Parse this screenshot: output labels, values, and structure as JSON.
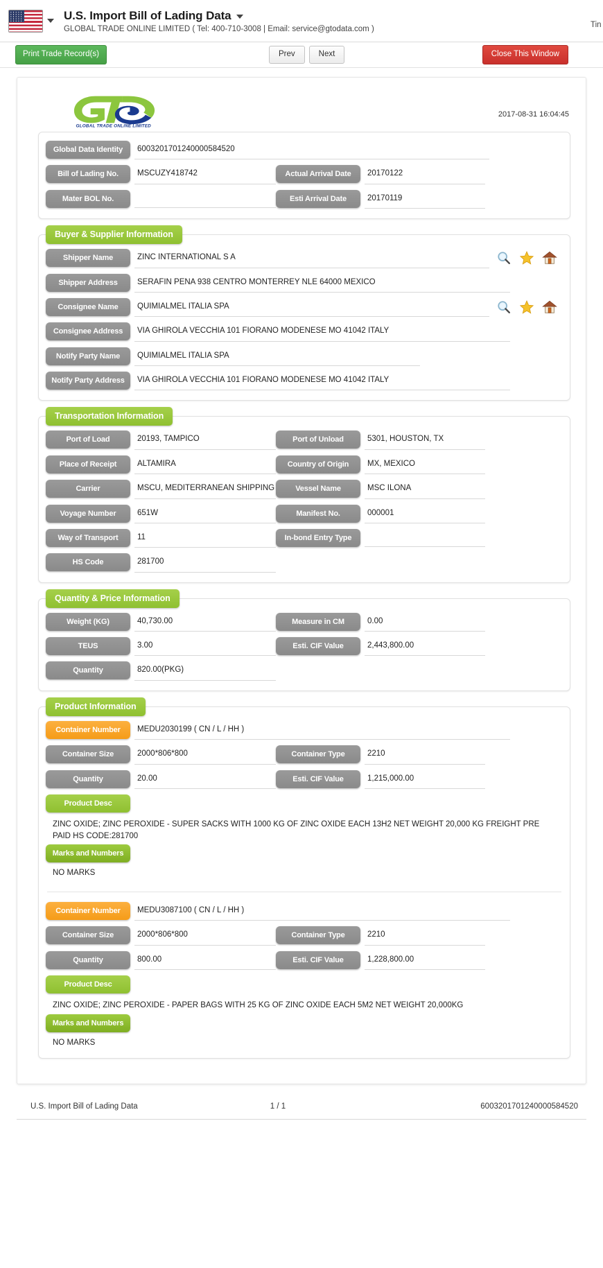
{
  "header": {
    "flag_icon": "us-flag-icon",
    "title": "U.S. Import Bill of Lading Data",
    "subtitle": "GLOBAL TRADE ONLINE LIMITED ( Tel: 400-710-3008 | Email: service@gtodata.com )",
    "right_clipped_text": "Tin"
  },
  "toolbar": {
    "print_label": "Print Trade Record(s)",
    "prev_label": "Prev",
    "next_label": "Next",
    "close_label": "Close This Window"
  },
  "document": {
    "logo_text": "GLOBAL TRADE  ONLINE LIMITED",
    "timestamp": "2017-08-31 16:04:45"
  },
  "identity": {
    "global_data_identity": {
      "label": "Global Data Identity",
      "value": "6003201701240000584520"
    },
    "bill_of_lading_no": {
      "label": "Bill of Lading No.",
      "value": "MSCUZY418742"
    },
    "actual_arrival_date": {
      "label": "Actual Arrival Date",
      "value": "20170122"
    },
    "mater_bol_no": {
      "label": "Mater BOL No.",
      "value": ""
    },
    "esti_arrival_date": {
      "label": "Esti Arrival Date",
      "value": "20170119"
    }
  },
  "buyer_supplier": {
    "legend": "Buyer & Supplier Information",
    "icons": [
      "search-icon",
      "star-icon",
      "home-icon"
    ],
    "fields": [
      {
        "label": "Shipper Name",
        "value": "ZINC INTERNATIONAL S A",
        "icons": true
      },
      {
        "label": "Shipper Address",
        "value": "SERAFIN PENA 938 CENTRO MONTERREY NLE 64000 MEXICO",
        "icons": false
      },
      {
        "label": "Consignee Name",
        "value": "QUIMIALMEL ITALIA SPA",
        "icons": true
      },
      {
        "label": "Consignee Address",
        "value": "VIA GHIROLA VECCHIA 101 FIORANO MODENESE MO 41042 ITALY",
        "icons": false
      },
      {
        "label": "Notify Party Name",
        "value": "QUIMIALMEL ITALIA SPA",
        "icons": false
      },
      {
        "label": "Notify Party Address",
        "value": "VIA GHIROLA VECCHIA 101 FIORANO MODENESE MO 41042 ITALY",
        "icons": false
      }
    ]
  },
  "transportation": {
    "legend": "Transportation Information",
    "rows": [
      {
        "l_label": "Port of Load",
        "l_value": "20193, TAMPICO",
        "r_label": "Port of Unload",
        "r_value": "5301, HOUSTON, TX"
      },
      {
        "l_label": "Place of Receipt",
        "l_value": "ALTAMIRA",
        "r_label": "Country of Origin",
        "r_value": "MX, MEXICO"
      },
      {
        "l_label": "Carrier",
        "l_value": "MSCU, MEDITERRANEAN SHIPPING C",
        "r_label": "Vessel Name",
        "r_value": "MSC ILONA"
      },
      {
        "l_label": "Voyage Number",
        "l_value": "651W",
        "r_label": "Manifest No.",
        "r_value": "000001"
      },
      {
        "l_label": "Way of Transport",
        "l_value": "11",
        "r_label": "In-bond Entry Type",
        "r_value": ""
      }
    ],
    "hs_code": {
      "label": "HS Code",
      "value": "281700"
    }
  },
  "quantity_price": {
    "legend": "Quantity & Price Information",
    "rows": [
      {
        "l_label": "Weight (KG)",
        "l_value": "40,730.00",
        "r_label": "Measure in CM",
        "r_value": "0.00"
      },
      {
        "l_label": "TEUS",
        "l_value": "3.00",
        "r_label": "Esti. CIF Value",
        "r_value": "2,443,800.00"
      }
    ],
    "quantity": {
      "label": "Quantity",
      "value": "820.00(PKG)"
    }
  },
  "product_information": {
    "legend": "Product Information",
    "containers": [
      {
        "container_number_label": "Container Number",
        "container_number_value": "MEDU2030199 ( CN / L / HH )",
        "container_size_label": "Container Size",
        "container_size_value": "2000*806*800",
        "container_type_label": "Container Type",
        "container_type_value": "2210",
        "quantity_label": "Quantity",
        "quantity_value": "20.00",
        "cif_label": "Esti. CIF Value",
        "cif_value": "1,215,000.00",
        "product_desc_label": "Product Desc",
        "product_desc_value": "ZINC OXIDE; ZINC PEROXIDE - SUPER SACKS WITH 1000 KG OF ZINC OXIDE EACH 13H2 NET WEIGHT 20,000 KG FREIGHT PRE PAID HS CODE:281700",
        "marks_label": "Marks and Numbers",
        "marks_value": "NO MARKS"
      },
      {
        "container_number_label": "Container Number",
        "container_number_value": "MEDU3087100 ( CN / L / HH )",
        "container_size_label": "Container Size",
        "container_size_value": "2000*806*800",
        "container_type_label": "Container Type",
        "container_type_value": "2210",
        "quantity_label": "Quantity",
        "quantity_value": "800.00",
        "cif_label": "Esti. CIF Value",
        "cif_value": "1,228,800.00",
        "product_desc_label": "Product Desc",
        "product_desc_value": "ZINC OXIDE; ZINC PEROXIDE - PAPER BAGS WITH 25 KG OF ZINC OXIDE EACH 5M2 NET WEIGHT 20,000KG",
        "marks_label": "Marks and Numbers",
        "marks_value": "NO MARKS"
      }
    ]
  },
  "footer": {
    "left": "U.S. Import Bill of Lading Data",
    "page": "1 / 1",
    "right": "6003201701240000584520"
  },
  "colors": {
    "green": "#8fc031",
    "orange": "#f59c18",
    "gray_label": "#8a8a8a",
    "red": "#c9302c",
    "print_green": "#46a046",
    "logo_green": "#8cc63e",
    "logo_blue": "#1a3a8f"
  }
}
